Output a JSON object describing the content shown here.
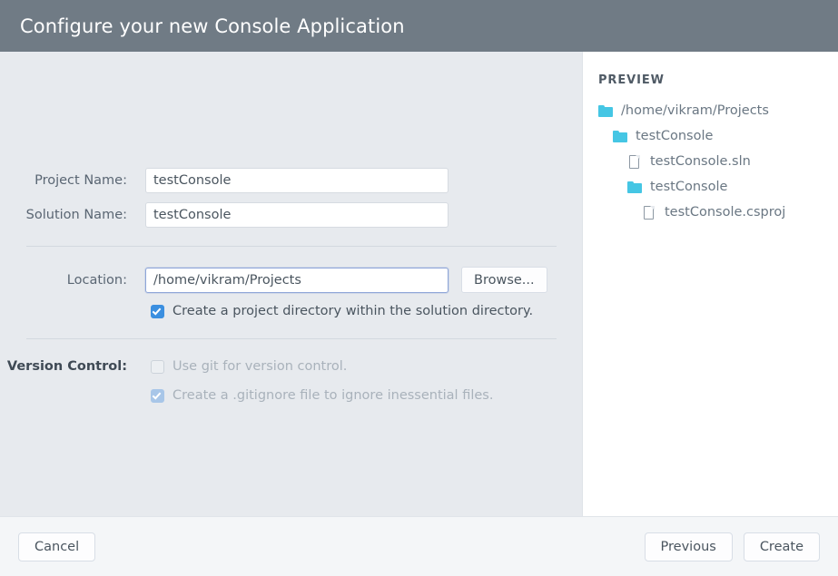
{
  "header": {
    "title": "Configure your new Console Application"
  },
  "form": {
    "project_name": {
      "label": "Project Name:",
      "value": "testConsole",
      "placeholder": ""
    },
    "solution_name": {
      "label": "Solution Name:",
      "value": "testConsole",
      "placeholder": ""
    },
    "location": {
      "label": "Location:",
      "value": "/home/vikram/Projects",
      "placeholder": "",
      "browse_label": "Browse..."
    },
    "create_project_directory": {
      "label": "Create a project directory within the solution directory.",
      "checked": true,
      "disabled": false
    },
    "version_control": {
      "label": "Version Control:",
      "use_git": {
        "label": "Use git for version control.",
        "checked": false,
        "disabled": true
      },
      "gitignore": {
        "label": "Create a .gitignore file to ignore inessential files.",
        "checked": true,
        "disabled": true
      }
    }
  },
  "preview": {
    "heading": "PREVIEW",
    "tree": [
      {
        "label": "/home/vikram/Projects",
        "type": "folder",
        "depth": 0
      },
      {
        "label": "testConsole",
        "type": "folder",
        "depth": 1
      },
      {
        "label": "testConsole.sln",
        "type": "file",
        "depth": 2
      },
      {
        "label": "testConsole",
        "type": "folder",
        "depth": 2
      },
      {
        "label": "testConsole.csproj",
        "type": "file",
        "depth": 3
      }
    ]
  },
  "footer": {
    "cancel_label": "Cancel",
    "previous_label": "Previous",
    "create_label": "Create"
  },
  "colors": {
    "header_bg": "#707b85",
    "body_bg": "#e7eaee",
    "panel_bg": "#ffffff",
    "footer_bg": "#f4f6f8",
    "accent_checkbox": "#3b8fe0",
    "folder_icon": "#45c6e4",
    "focus_border": "#8fa6d8"
  }
}
